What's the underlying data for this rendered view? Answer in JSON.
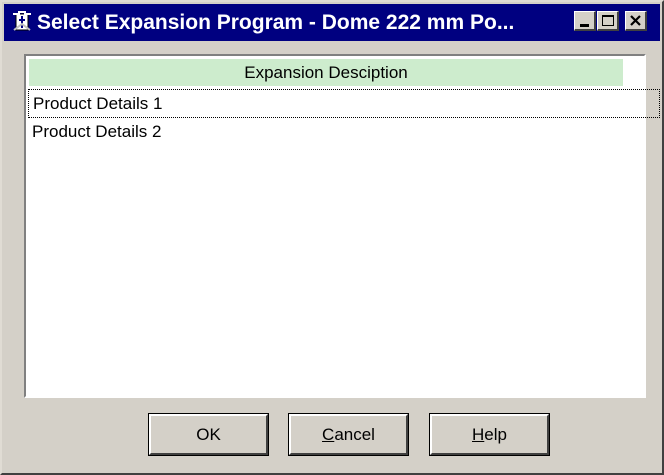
{
  "window": {
    "title": "Select Expansion Program - Dome 222 mm Po...",
    "app_icon": "wizard-app-icon",
    "controls": [
      "minimize-icon",
      "maximize-icon",
      "close-icon"
    ]
  },
  "list": {
    "column_header": "Expansion Desciption",
    "items": [
      {
        "label": "Product Details 1",
        "focused": true
      },
      {
        "label": "Product Details 2",
        "focused": false
      }
    ]
  },
  "buttons": {
    "ok_label": "OK",
    "cancel_first": "C",
    "cancel_rest": "ancel",
    "help_first": "H",
    "help_rest": "elp"
  },
  "colors": {
    "titlebar": "#000080",
    "face": "#d4d0c8",
    "header_bg": "#cdeccd"
  }
}
